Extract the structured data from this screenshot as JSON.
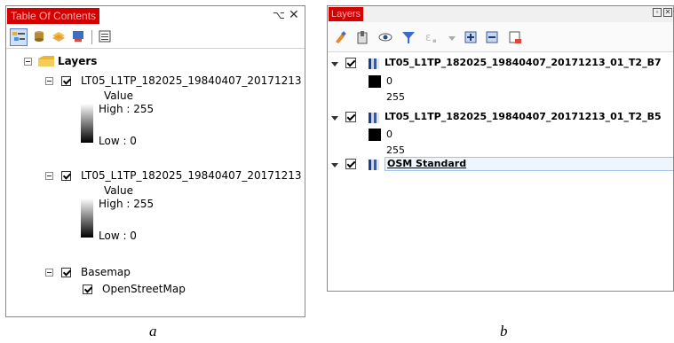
{
  "panel_a": {
    "title": "Table Of Contents",
    "pin_glyph": "⌥",
    "close_glyph": "✕",
    "toolbar_icons": [
      "list-by-drawing-order-icon",
      "list-by-source-icon",
      "list-by-visibility-icon",
      "list-by-selection-icon",
      "options-icon"
    ],
    "root_label": "Layers",
    "layers": [
      {
        "name": "LT05_L1TP_182025_19840407_20171213",
        "field": "Value",
        "high": "High : 255",
        "low": "Low : 0"
      },
      {
        "name": "LT05_L1TP_182025_19840407_20171213",
        "field": "Value",
        "high": "High : 255",
        "low": "Low : 0"
      }
    ],
    "basemap": {
      "name": "Basemap",
      "child": "OpenStreetMap"
    },
    "caption": "a"
  },
  "panel_b": {
    "title": "Layers",
    "toolbar_icons": [
      "style-icon",
      "add-group-icon",
      "manage-visibility-icon",
      "filter-icon",
      "filter-expression-icon",
      "expand-all-icon",
      "collapse-all-icon",
      "remove-layer-icon"
    ],
    "layers": [
      {
        "name": "LT05_L1TP_182025_19840407_20171213_01_T2_B7",
        "min": "0",
        "max": "255"
      },
      {
        "name": "LT05_L1TP_182025_19840407_20171213_01_T2_B5",
        "min": "0",
        "max": "255"
      }
    ],
    "osm": {
      "name": "OSM Standard"
    },
    "caption": "b"
  },
  "colors": {
    "title_highlight": "#d40000",
    "selection_border": "#9ec3ea"
  }
}
